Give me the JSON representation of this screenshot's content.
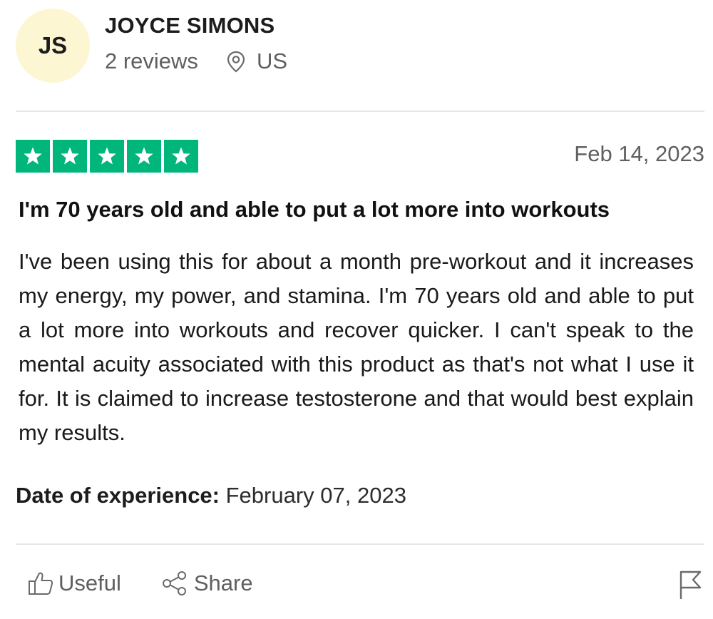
{
  "reviewer": {
    "initials": "JS",
    "name": "JOYCE SIMONS",
    "review_count": "2 reviews",
    "location": "US",
    "avatar_color": "#fdf6d2"
  },
  "review": {
    "rating": 5,
    "rating_max": 5,
    "star_color": "#00b67a",
    "date": "Feb 14, 2023",
    "title": "I'm 70 years old and able to put a lot more into workouts",
    "body": "I've been using this for about a month pre-workout and it increases my energy, my power, and stamina. I'm 70 years old and able to put a lot more into workouts and recover quicker. I can't speak to the mental acuity associated with this product as that's not what I use it for. It is claimed to increase testosterone and that would best explain my results.",
    "experience_label": "Date of experience:",
    "experience_date": "February 07, 2023"
  },
  "actions": {
    "useful_label": "Useful",
    "share_label": "Share"
  },
  "icons": {
    "location": "map-pin-icon",
    "useful": "thumbs-up-icon",
    "share": "share-icon",
    "flag": "flag-icon",
    "star": "star-icon"
  }
}
